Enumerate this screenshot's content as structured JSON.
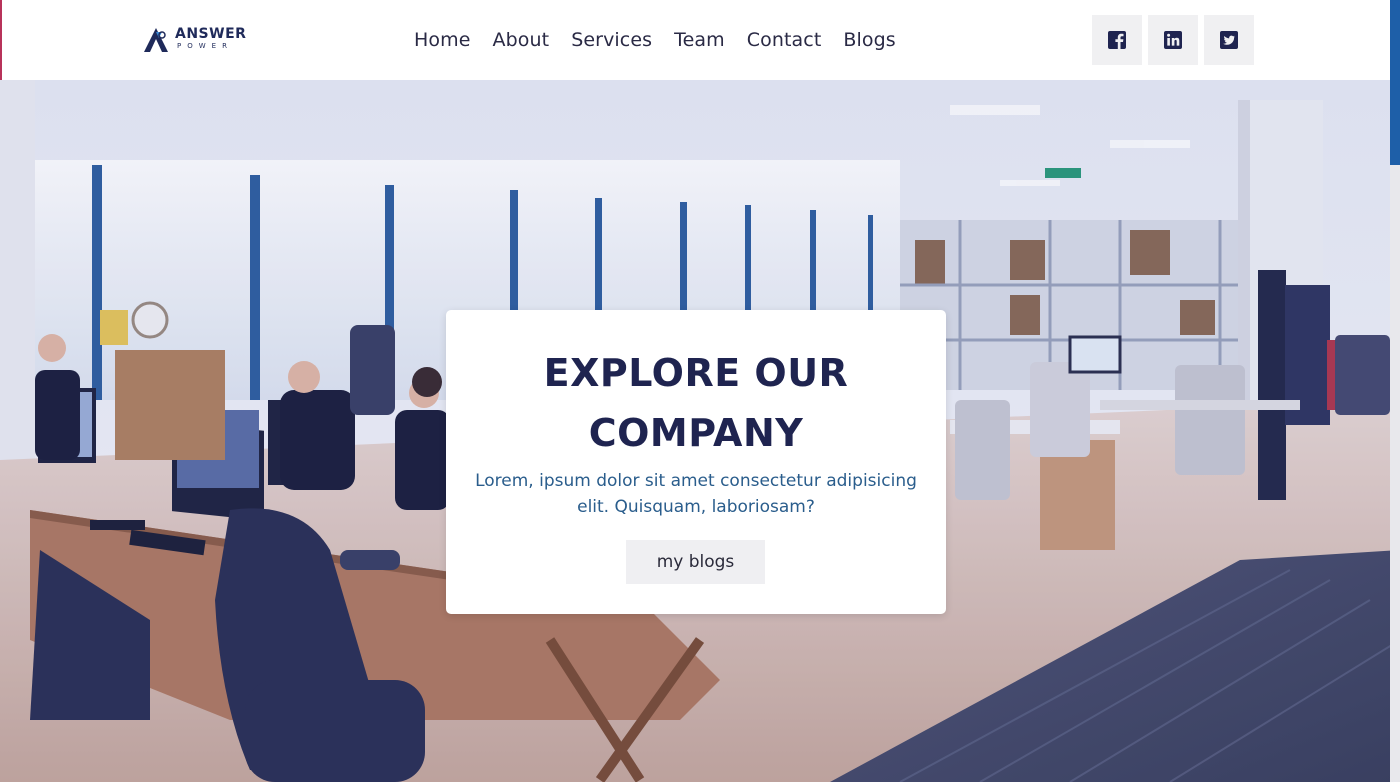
{
  "brand": {
    "name": "ANSWER",
    "sub": "POWER"
  },
  "nav": {
    "items": [
      {
        "label": "Home"
      },
      {
        "label": "About"
      },
      {
        "label": "Services"
      },
      {
        "label": "Team"
      },
      {
        "label": "Contact"
      },
      {
        "label": "Blogs"
      }
    ]
  },
  "socials": [
    {
      "icon": "facebook-icon"
    },
    {
      "icon": "linkedin-icon"
    },
    {
      "icon": "twitter-icon"
    }
  ],
  "hero": {
    "title_line1": "EXPLORE OUR",
    "title_line2": "COMPANY",
    "text": "Lorem, ipsum dolor sit amet consectetur adipisicing elit. Quisquam, laboriosam?",
    "button": "my blogs"
  },
  "colors": {
    "brand_navy": "#1f2450",
    "text_blue": "#2a5d8c",
    "scroll_accent": "#1e5fa8"
  }
}
